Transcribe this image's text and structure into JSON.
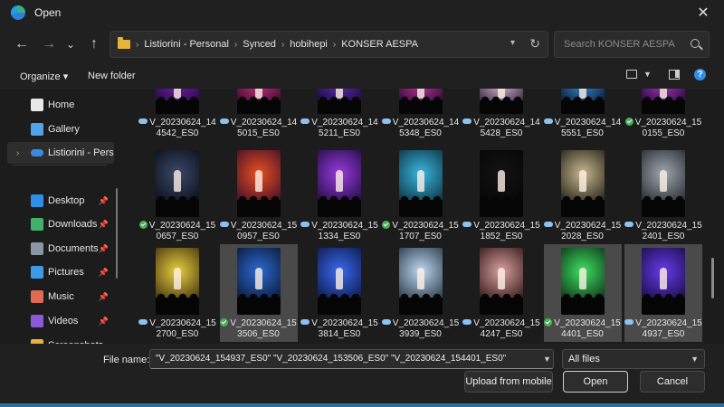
{
  "window": {
    "title": "Open",
    "close_glyph": "✕"
  },
  "nav": {
    "back_glyph": "←",
    "forward_glyph": "→",
    "dropdown_glyph": "⌄",
    "up_glyph": "↑",
    "breadcrumbs": [
      "Listiorini - Personal",
      "Synced",
      "hobihepi",
      "KONSER AESPA"
    ],
    "separator_glyph": "›",
    "search_placeholder": "Search KONSER AESPA"
  },
  "toolbar": {
    "organize_label": "Organize ▾",
    "new_folder_label": "New folder",
    "help_glyph": "?"
  },
  "sidebar": {
    "items": [
      {
        "label": "Home",
        "icon": "home-icon",
        "color": "#e8e8e8"
      },
      {
        "label": "Gallery",
        "icon": "gallery-icon",
        "color": "#4fa3e6"
      },
      {
        "label": "Listiorini - Perso",
        "icon": "onedrive-icon",
        "color": "#3a8be0"
      },
      {
        "label": "Desktop",
        "icon": "desktop-icon",
        "color": "#2f8fe6"
      },
      {
        "label": "Downloads",
        "icon": "download-icon",
        "color": "#45b06a"
      },
      {
        "label": "Documents",
        "icon": "documents-icon",
        "color": "#8a95a6"
      },
      {
        "label": "Pictures",
        "icon": "pictures-icon",
        "color": "#3d9ae6"
      },
      {
        "label": "Music",
        "icon": "music-icon",
        "color": "#e06b52"
      },
      {
        "label": "Videos",
        "icon": "videos-icon",
        "color": "#8b5ad8"
      },
      {
        "label": "Screenshots",
        "icon": "folder-icon",
        "color": "#e8b33a"
      }
    ],
    "pin_glyph": "📌",
    "expand_glyph": "›"
  },
  "files": [
    {
      "line1": "V_20230624_14",
      "line2": "4542_ES0",
      "status": "cloud",
      "selected": false,
      "c1": "#7a1fb8",
      "c2": "#2a0a45"
    },
    {
      "line1": "V_20230624_14",
      "line2": "5015_ES0",
      "status": "cloud",
      "selected": false,
      "c1": "#e0358f",
      "c2": "#3a0a2a"
    },
    {
      "line1": "V_20230624_14",
      "line2": "5211_ES0",
      "status": "cloud",
      "selected": false,
      "c1": "#6a2fc0",
      "c2": "#1a0a40"
    },
    {
      "line1": "V_20230624_14",
      "line2": "5348_ES0",
      "status": "cloud",
      "selected": false,
      "c1": "#d03aa8",
      "c2": "#300a3a"
    },
    {
      "line1": "V_20230624_14",
      "line2": "5428_ES0",
      "status": "cloud",
      "selected": false,
      "c1": "#f0c8e8",
      "c2": "#3a2a40"
    },
    {
      "line1": "V_20230624_14",
      "line2": "5551_ES0",
      "status": "cloud",
      "selected": false,
      "c1": "#3a9ae0",
      "c2": "#0a1a3a"
    },
    {
      "line1": "V_20230624_15",
      "line2": "0155_ES0",
      "status": "ok",
      "selected": false,
      "c1": "#b03ad0",
      "c2": "#2a0a3a"
    },
    {
      "line1": "V_20230624_15",
      "line2": "0657_ES0",
      "status": "ok",
      "selected": false,
      "c1": "#3a4a6a",
      "c2": "#0a0a14"
    },
    {
      "line1": "V_20230624_15",
      "line2": "0957_ES0",
      "status": "cloud",
      "selected": false,
      "c1": "#e85020",
      "c2": "#3a0a2a"
    },
    {
      "line1": "V_20230624_15",
      "line2": "1334_ES0",
      "status": "cloud",
      "selected": false,
      "c1": "#9a3ae0",
      "c2": "#1a0a3a"
    },
    {
      "line1": "V_20230624_15",
      "line2": "1707_ES0",
      "status": "ok",
      "selected": false,
      "c1": "#3ab8e0",
      "c2": "#0a2a3a"
    },
    {
      "line1": "V_20230624_15",
      "line2": "1852_ES0",
      "status": "cloud",
      "selected": false,
      "c1": "#141414",
      "c2": "#050505"
    },
    {
      "line1": "V_20230624_15",
      "line2": "2028_ES0",
      "status": "cloud",
      "selected": false,
      "c1": "#c8b890",
      "c2": "#1a1a10"
    },
    {
      "line1": "V_20230624_15",
      "line2": "2401_ES0",
      "status": "cloud",
      "selected": false,
      "c1": "#a0a8b0",
      "c2": "#20242a"
    },
    {
      "line1": "V_20230624_15",
      "line2": "2700_ES0",
      "status": "cloud",
      "selected": false,
      "c1": "#e8d040",
      "c2": "#3a2a0a"
    },
    {
      "line1": "V_20230624_15",
      "line2": "3506_ES0",
      "status": "ok",
      "selected": true,
      "c1": "#2a6ad0",
      "c2": "#0a1430"
    },
    {
      "line1": "V_20230624_15",
      "line2": "3814_ES0",
      "status": "cloud",
      "selected": false,
      "c1": "#3a6af0",
      "c2": "#0a1440"
    },
    {
      "line1": "V_20230624_15",
      "line2": "3939_ES0",
      "status": "cloud",
      "selected": false,
      "c1": "#c0d8f0",
      "c2": "#203040"
    },
    {
      "line1": "V_20230624_15",
      "line2": "4247_ES0",
      "status": "cloud",
      "selected": false,
      "c1": "#d8a0a0",
      "c2": "#2a1010"
    },
    {
      "line1": "V_20230624_15",
      "line2": "4401_ES0",
      "status": "ok",
      "selected": true,
      "c1": "#40e060",
      "c2": "#0a2a14"
    },
    {
      "line1": "V_20230624_15",
      "line2": "4937_ES0",
      "status": "cloud",
      "selected": true,
      "c1": "#6a3ae8",
      "c2": "#140a40"
    }
  ],
  "footer": {
    "file_name_label": "File name:",
    "file_name_value": "\"V_20230624_154937_ES0\" \"V_20230624_153506_ES0\" \"V_20230624_154401_ES0\"",
    "filter_value": "All files",
    "upload_label": "Upload from mobile",
    "open_label": "Open",
    "cancel_label": "Cancel"
  }
}
